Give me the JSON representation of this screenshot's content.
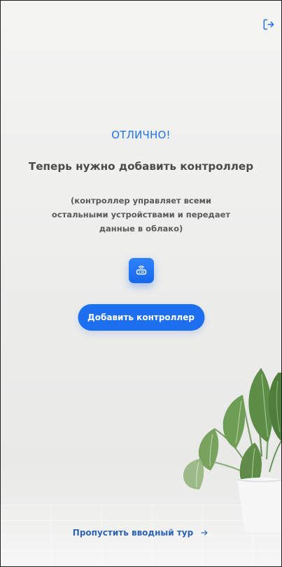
{
  "header": {
    "logout_icon": "logout-icon"
  },
  "main": {
    "headline": "ОТЛИЧНО!",
    "subtitle": "Теперь нужно добавить контроллер",
    "description": "(контроллер управляет всеми остальными устройствами и передает данные в облако)",
    "device_icon": "controller-icon",
    "add_controller_label": "Добавить контроллер"
  },
  "footer": {
    "skip_tour_label": "Пропустить вводный тур",
    "arrow_icon": "arrow-right-icon"
  },
  "colors": {
    "accent": "#1d6ff0",
    "headline": "#1f73e8",
    "text": "#4a4a4a",
    "background": "#ececeb"
  }
}
